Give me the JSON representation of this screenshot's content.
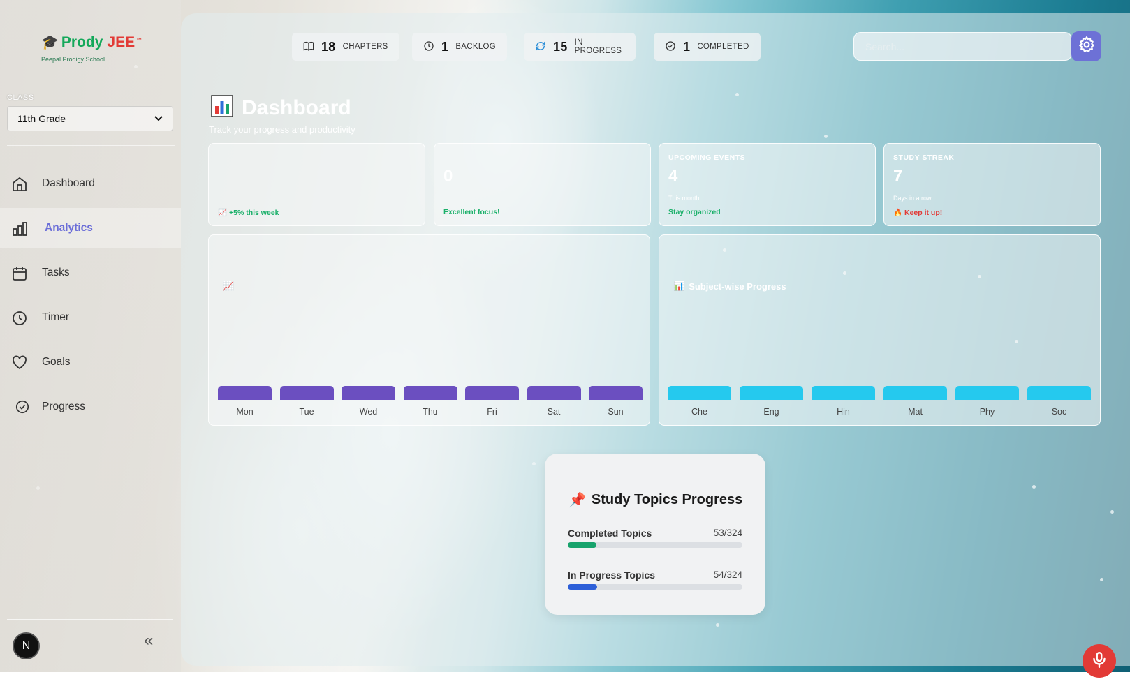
{
  "brand": {
    "name_part1": "Prody",
    "name_part2": "JEE",
    "tm": "™",
    "school": "Peepal Prodigy School"
  },
  "class_selector": {
    "label": "CLASS",
    "selected": "11th Grade"
  },
  "nav": [
    {
      "label": "Dashboard",
      "icon": "home-icon"
    },
    {
      "label": "Analytics",
      "icon": "bar-chart-icon",
      "active": true
    },
    {
      "label": "Tasks",
      "icon": "calendar-icon"
    },
    {
      "label": "Timer",
      "icon": "clock-icon"
    },
    {
      "label": "Goals",
      "icon": "heart-icon"
    },
    {
      "label": "Progress",
      "icon": "check-circle-icon"
    }
  ],
  "user": {
    "initial": "N"
  },
  "collapse_label": "«",
  "stats": [
    {
      "value": "18",
      "label": "CHAPTERS",
      "icon": "book-icon"
    },
    {
      "value": "1",
      "label": "BACKLOG",
      "icon": "clock-icon"
    },
    {
      "value": "15",
      "label": "IN PROGRESS",
      "icon": "refresh-icon"
    },
    {
      "value": "1",
      "label": "COMPLETED",
      "icon": "check-circle-icon"
    }
  ],
  "search": {
    "placeholder": "Search..."
  },
  "dashboard": {
    "title": "Dashboard",
    "subtitle": "Track your progress and productivity"
  },
  "cards": [
    {
      "label": "",
      "value": "",
      "sub": "",
      "foot": "+5% this week",
      "foot_icon": "📈"
    },
    {
      "label": "",
      "value": "0",
      "sub": "",
      "foot": "Excellent focus!"
    },
    {
      "label": "UPCOMING EVENTS",
      "value": "4",
      "sub": "This month",
      "foot": "Stay organized"
    },
    {
      "label": "STUDY STREAK",
      "value": "7",
      "sub": "Days in a row",
      "foot": "Keep it up!",
      "foot_icon": "🔥"
    }
  ],
  "weekly_panel": {
    "icon": "📈",
    "title": ""
  },
  "subject_panel": {
    "icon": "📊",
    "title": "Subject-wise Progress"
  },
  "chart_data": [
    {
      "type": "bar",
      "categories": [
        "Mon",
        "Tue",
        "Wed",
        "Thu",
        "Fri",
        "Sat",
        "Sun"
      ],
      "values": [
        0,
        0,
        0,
        0,
        0,
        0,
        0
      ],
      "color": "#6b4fc0"
    },
    {
      "type": "bar",
      "title": "Subject-wise Progress",
      "categories": [
        "Che",
        "Eng",
        "Hin",
        "Mat",
        "Phy",
        "Soc"
      ],
      "values": [
        0,
        0,
        0,
        0,
        0,
        0
      ],
      "color": "#25c9ee"
    }
  ],
  "topics": {
    "icon": "📌",
    "title": "Study Topics Progress",
    "rows": [
      {
        "label": "Completed Topics",
        "value": "53/324",
        "fraction": 0.1636,
        "color": "#18a36c"
      },
      {
        "label": "In Progress Topics",
        "value": "54/324",
        "fraction": 0.1667,
        "color": "#2d5fd8"
      }
    ]
  },
  "colors": {
    "accent": "#6d71d6",
    "mic": "#e23a36"
  }
}
